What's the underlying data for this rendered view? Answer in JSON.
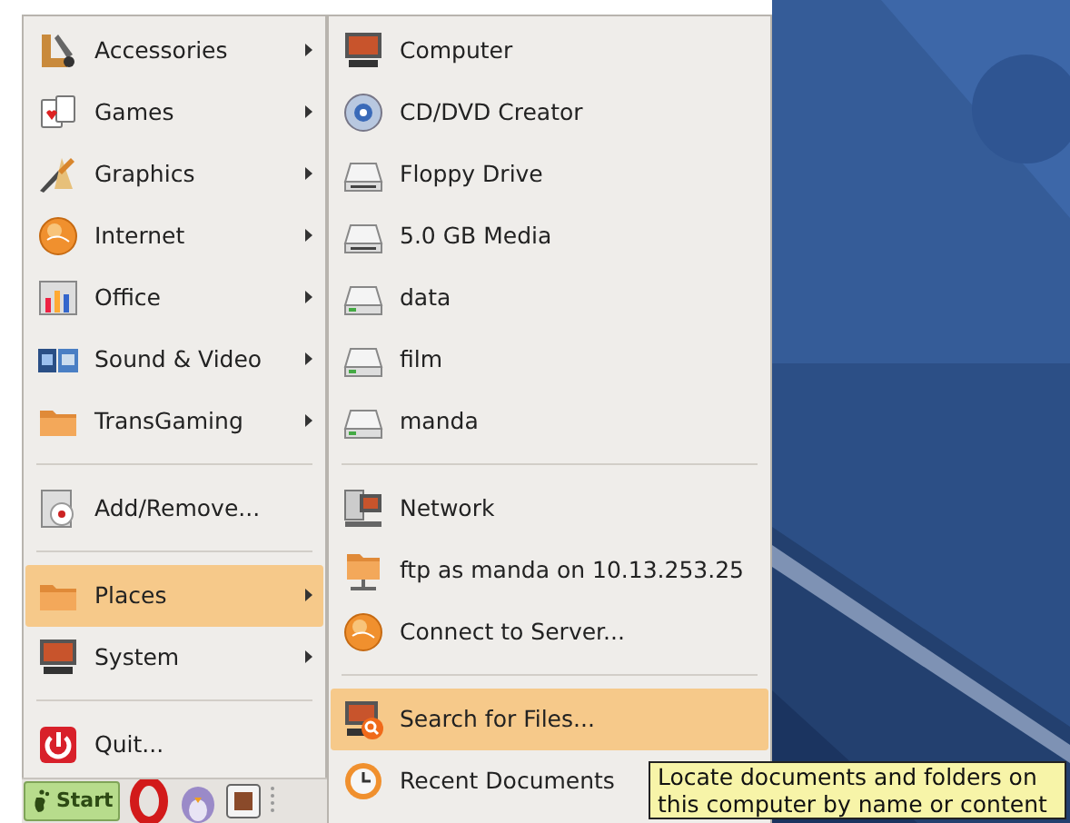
{
  "main_menu": {
    "items": [
      {
        "kind": "item",
        "label": "Accessories",
        "has_submenu": true,
        "selected": false
      },
      {
        "kind": "item",
        "label": "Games",
        "has_submenu": true,
        "selected": false
      },
      {
        "kind": "item",
        "label": "Graphics",
        "has_submenu": true,
        "selected": false
      },
      {
        "kind": "item",
        "label": "Internet",
        "has_submenu": true,
        "selected": false
      },
      {
        "kind": "item",
        "label": "Office",
        "has_submenu": true,
        "selected": false
      },
      {
        "kind": "item",
        "label": "Sound & Video",
        "has_submenu": true,
        "selected": false
      },
      {
        "kind": "item",
        "label": "TransGaming",
        "has_submenu": true,
        "selected": false
      },
      {
        "kind": "separator"
      },
      {
        "kind": "item",
        "label": "Add/Remove...",
        "has_submenu": false,
        "selected": false
      },
      {
        "kind": "separator"
      },
      {
        "kind": "item",
        "label": "Places",
        "has_submenu": true,
        "selected": true
      },
      {
        "kind": "item",
        "label": "System",
        "has_submenu": true,
        "selected": false
      },
      {
        "kind": "separator"
      },
      {
        "kind": "item",
        "label": "Quit...",
        "has_submenu": false,
        "selected": false
      }
    ]
  },
  "places_menu": {
    "items": [
      {
        "kind": "item",
        "label": "Computer",
        "selected": false
      },
      {
        "kind": "item",
        "label": "CD/DVD Creator",
        "selected": false
      },
      {
        "kind": "item",
        "label": "Floppy Drive",
        "selected": false
      },
      {
        "kind": "item",
        "label": "5.0 GB Media",
        "selected": false
      },
      {
        "kind": "item",
        "label": "data",
        "selected": false
      },
      {
        "kind": "item",
        "label": "film",
        "selected": false
      },
      {
        "kind": "item",
        "label": "manda",
        "selected": false
      },
      {
        "kind": "separator"
      },
      {
        "kind": "item",
        "label": "Network",
        "selected": false
      },
      {
        "kind": "item",
        "label": "ftp as manda on 10.13.253.25",
        "selected": false
      },
      {
        "kind": "item",
        "label": "Connect to Server...",
        "selected": false
      },
      {
        "kind": "separator"
      },
      {
        "kind": "item",
        "label": "Search for Files...",
        "selected": true
      },
      {
        "kind": "item",
        "label": "Recent Documents",
        "selected": false
      }
    ]
  },
  "taskbar": {
    "start_button": "Start"
  },
  "tooltip": {
    "text": "Locate documents and folders on this computer by name or content"
  }
}
